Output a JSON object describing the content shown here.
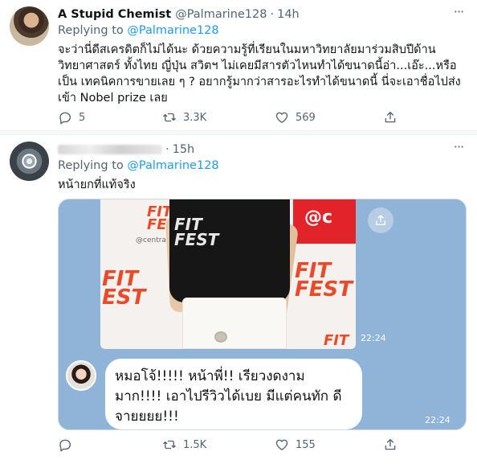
{
  "tweets": [
    {
      "name": "A Stupid Chemist",
      "handle": "@Palmarine128",
      "time": "14h",
      "replying_prefix": "Replying to",
      "replying_to": "@Palmarine128",
      "text": "จะว่านี่ดีสเครดิตก็ไม่ได้นะ ด้วยความรู้ที่เรียนในมหาวิทยาลัยมาร่วมสิบปีด้าน วิทยาศาสตร์ ทั้งไทย ญี่ปุ่น สวิตฯ ไม่เคยมีสารตัวไหนทำได้ขนาดนี้อ่า...เอ๊ะ...หรือเป็น เทคนิคการขายเลย ๆ ? อยากรู้มากว่าสารอะไรทำได้ขนาดนี้ นี่จะเอาชื่อไปส่งเข้า Nobel prize เลย",
      "replies": "5",
      "retweets": "3.3K",
      "likes": "569"
    },
    {
      "time": "15h",
      "replying_prefix": "Replying to",
      "replying_to": "@Palmarine128",
      "text": "หน้ายกที่แท้จริง",
      "media": {
        "backdrop_text": "@c",
        "fit_fest_text": "FIT\nFEST",
        "central_text": "@centralwOrld",
        "photo_time": "22:24",
        "bubble_text": "หมอโจ้!!!!! หน้าพี่!! เรียวงดงาม มาก!!!! เอาไปรีวิวได้เบย มีแต่คนทัก ดีจายยยย!!!",
        "bubble_time": "22:24"
      },
      "replies": "",
      "retweets": "1.5K",
      "likes": "155"
    }
  ],
  "icons": {
    "more": "more-dots-icon",
    "reply": "reply-icon",
    "retweet": "retweet-icon",
    "like": "heart-icon",
    "share": "share-icon"
  },
  "colors": {
    "link": "#1d9bf0",
    "secondary_text": "#536471",
    "chat_background": "#8fb4d8",
    "fit_fest_red": "#e94b2a"
  }
}
